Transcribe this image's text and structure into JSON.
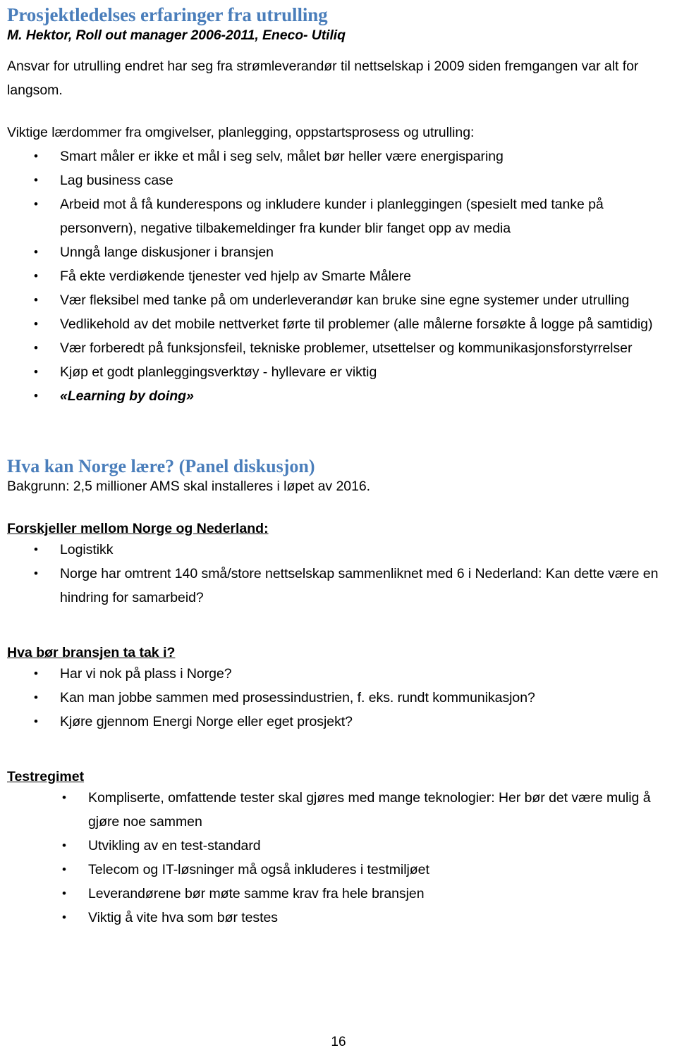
{
  "document": {
    "title": "Prosjektledelses erfaringer fra utrulling",
    "subtitle": "M. Hektor, Roll out manager 2006-2011, Eneco- Utiliq",
    "intro_paragraph": "Ansvar for utrulling endret har seg fra strømleverandør til nettselskap i 2009 siden fremgangen var alt for langsom.",
    "lessons_lead": "Viktige lærdommer fra omgivelser, planlegging, oppstartsprosess og utrulling:",
    "lessons": [
      "Smart måler er ikke et mål i seg selv, målet bør heller være energisparing",
      "Lag business case",
      "Arbeid mot å få kunderespons og inkludere kunder i planleggingen (spesielt med tanke på personvern), negative tilbakemeldinger fra kunder blir fanget opp av media",
      "Unngå lange diskusjoner i bransjen",
      "Få ekte verdiøkende tjenester ved hjelp av Smarte Målere",
      "Vær fleksibel med tanke på om underleverandør kan bruke sine egne systemer under utrulling",
      "Vedlikehold av det mobile nettverket førte til problemer (alle målerne forsøkte å logge på samtidig)",
      "Vær forberedt på funksjonsfeil, tekniske problemer, utsettelser og kommunikasjonsforstyrrelser",
      "Kjøp et godt planleggingsverktøy - hyllevare er viktig"
    ],
    "lessons_emphasized": "«Learning by doing»",
    "section2": {
      "heading": "Hva kan Norge lære? (Panel diskusjon)",
      "background": "Bakgrunn: 2,5 millioner AMS skal installeres i løpet av 2016.",
      "sub1_heading": "Forskjeller mellom Norge og Nederland:",
      "sub1_items": [
        "Logistikk",
        "Norge har omtrent 140 små/store nettselskap sammenliknet med 6 i Nederland: Kan dette være en hindring for samarbeid?"
      ],
      "sub2_heading": "Hva bør bransjen ta tak i?",
      "sub2_items": [
        "Har vi nok på plass i Norge?",
        "Kan man jobbe sammen med prosessindustrien, f. eks. rundt kommunikasjon?",
        "Kjøre gjennom Energi Norge eller eget prosjekt?"
      ],
      "sub3_heading": "Testregimet",
      "sub3_items": [
        "Kompliserte, omfattende tester skal gjøres med mange teknologier: Her bør det være mulig å gjøre noe sammen",
        "Utvikling av en test-standard",
        "Telecom og IT-løsninger må også inkluderes i testmiljøet",
        "Leverandørene bør møte samme krav fra hele bransjen",
        "Viktig å vite hva som bør testes"
      ]
    },
    "page_number": "16",
    "colors": {
      "heading_blue": "#4A7EBB",
      "body_black": "#000000",
      "background": "#FFFFFF"
    }
  }
}
